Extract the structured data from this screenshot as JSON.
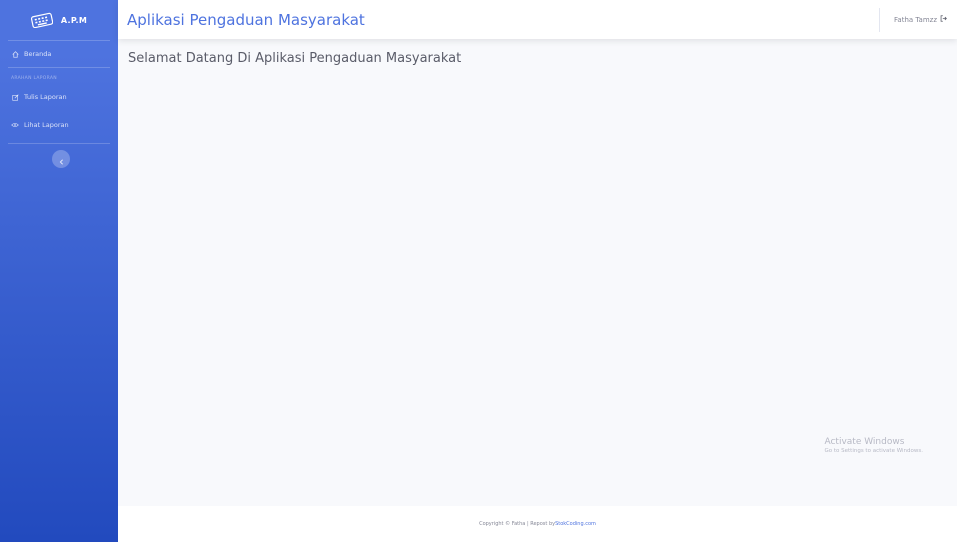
{
  "sidebar": {
    "brand": "A.P.M",
    "brand_icon": "keyboard-icon",
    "items": [
      {
        "label": "Beranda",
        "icon": "home-icon"
      },
      {
        "label": "Tulis Laporan",
        "icon": "edit-icon"
      },
      {
        "label": "Lihat Laporan",
        "icon": "eye-icon"
      }
    ],
    "heading": "ARAHAN LAPORAN",
    "toggle_icon": "chevron-left-icon"
  },
  "topbar": {
    "title": "Aplikasi Pengaduan Masyarakat",
    "user_name": "Fatha Tamzz",
    "logout_icon": "sign-out-icon"
  },
  "main": {
    "welcome": "Selamat Datang Di Aplikasi Pengaduan Masyarakat"
  },
  "watermark": {
    "title": "Activate Windows",
    "subtitle": "Go to Settings to activate Windows."
  },
  "footer": {
    "copyright": "Copyright © Fatha | Repost by ",
    "link": "StokCoding.com"
  },
  "colors": {
    "primary": "#4e73df",
    "sidebar_bottom": "#224abe",
    "background": "#f8f9fc"
  }
}
